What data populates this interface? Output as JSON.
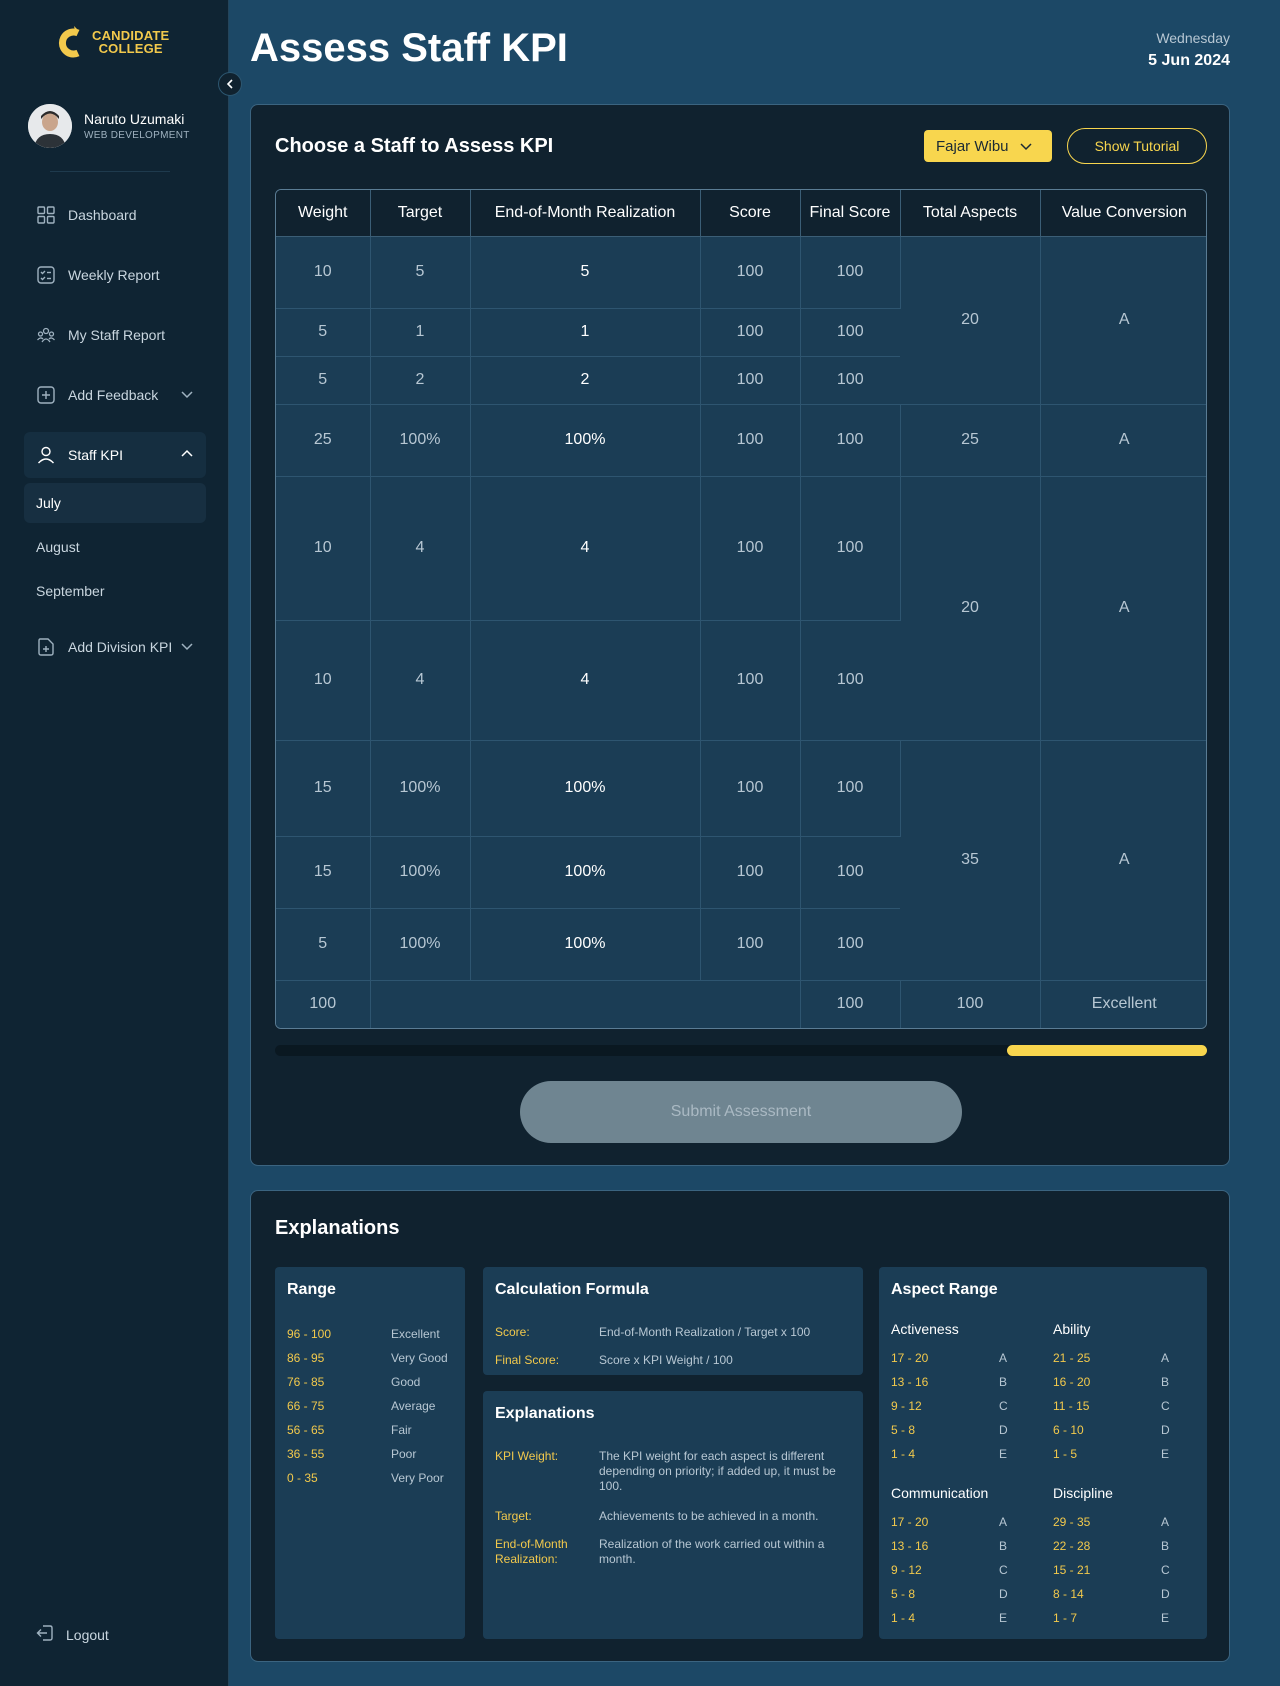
{
  "brand": {
    "line1": "CANDIDATE",
    "line2": "COLLEGE"
  },
  "user": {
    "name": "Naruto Uzumaki",
    "role": "WEB DEVELOPMENT"
  },
  "nav": {
    "dashboard": "Dashboard",
    "weekly": "Weekly Report",
    "staff_report": "My Staff Report",
    "feedback": "Add Feedback",
    "staff_kpi": "Staff KPI",
    "months": [
      "July",
      "August",
      "September"
    ],
    "division_kpi": "Add Division KPI",
    "logout": "Logout"
  },
  "header": {
    "title": "Assess Staff KPI",
    "day": "Wednesday",
    "date": "5 Jun 2024"
  },
  "assess": {
    "heading": "Choose a  Staff to Assess KPI",
    "selected_staff": "Fajar Wibu",
    "tutorial_label": "Show Tutorial",
    "submit_label": "Submit Assessment",
    "progress_fraction": [
      0.785,
      1.0
    ]
  },
  "table": {
    "headers": [
      "Weight",
      "Target",
      "End-of-Month Realization",
      "Score",
      "Final Score",
      "Total Aspects",
      "Value Conversion"
    ],
    "rows": [
      {
        "weight": "10",
        "target": "5",
        "realization": "5",
        "score": "100",
        "final": "100"
      },
      {
        "weight": "5",
        "target": "1",
        "realization": "1",
        "score": "100",
        "final": "100"
      },
      {
        "weight": "5",
        "target": "2",
        "realization": "2",
        "score": "100",
        "final": "100"
      },
      {
        "weight": "25",
        "target": "100%",
        "realization": "100%",
        "score": "100",
        "final": "100"
      },
      {
        "weight": "10",
        "target": "4",
        "realization": "4",
        "score": "100",
        "final": "100"
      },
      {
        "weight": "10",
        "target": "4",
        "realization": "4",
        "score": "100",
        "final": "100"
      },
      {
        "weight": "15",
        "target": "100%",
        "realization": "100%",
        "score": "100",
        "final": "100"
      },
      {
        "weight": "15",
        "target": "100%",
        "realization": "100%",
        "score": "100",
        "final": "100"
      },
      {
        "weight": "5",
        "target": "100%",
        "realization": "100%",
        "score": "100",
        "final": "100"
      }
    ],
    "groups": [
      {
        "total": "20",
        "value": "A"
      },
      {
        "total": "25",
        "value": "A"
      },
      {
        "total": "20",
        "value": "A"
      },
      {
        "total": "35",
        "value": "A"
      }
    ],
    "footer": {
      "weight": "100",
      "final": "100",
      "total": "100",
      "value": "Excellent"
    }
  },
  "explanations": {
    "title": "Explanations",
    "range": {
      "title": "Range",
      "items": [
        {
          "range": "96 - 100",
          "label": "Excellent"
        },
        {
          "range": "86 - 95",
          "label": "Very Good"
        },
        {
          "range": "76 - 85",
          "label": "Good"
        },
        {
          "range": "66 - 75",
          "label": "Average"
        },
        {
          "range": "56 - 65",
          "label": "Fair"
        },
        {
          "range": "36 - 55",
          "label": "Poor"
        },
        {
          "range": "0 - 35",
          "label": "Very Poor"
        }
      ]
    },
    "formula": {
      "title": "Calculation Formula",
      "items": [
        {
          "key": "Score:",
          "value": "End-of-Month Realization / Target x 100"
        },
        {
          "key": "Final Score:",
          "value": "Score x KPI Weight / 100"
        }
      ]
    },
    "definitions": {
      "title": "Explanations",
      "items": [
        {
          "key": "KPI Weight:",
          "value": "The KPI weight for each aspect is different depending on priority; if added up, it must be 100."
        },
        {
          "key": "Target:",
          "value": "Achievements to be achieved in a month."
        },
        {
          "key": "End-of-Month Realization:",
          "value": "Realization of the work carried out within a month."
        }
      ]
    },
    "aspect_range": {
      "title": "Aspect Range",
      "groups": [
        {
          "name": "Activeness",
          "items": [
            [
              "17 - 20",
              "A"
            ],
            [
              "13 - 16",
              "B"
            ],
            [
              "9 - 12",
              "C"
            ],
            [
              "5 - 8",
              "D"
            ],
            [
              "1 - 4",
              "E"
            ]
          ]
        },
        {
          "name": "Ability",
          "items": [
            [
              "21 - 25",
              "A"
            ],
            [
              "16 - 20",
              "B"
            ],
            [
              "11 - 15",
              "C"
            ],
            [
              "6 - 10",
              "D"
            ],
            [
              "1 - 5",
              "E"
            ]
          ]
        },
        {
          "name": "Communication",
          "items": [
            [
              "17 - 20",
              "A"
            ],
            [
              "13 - 16",
              "B"
            ],
            [
              "9 - 12",
              "C"
            ],
            [
              "5 - 8",
              "D"
            ],
            [
              "1 - 4",
              "E"
            ]
          ]
        },
        {
          "name": "Discipline",
          "items": [
            [
              "29 - 35",
              "A"
            ],
            [
              "22 - 28",
              "B"
            ],
            [
              "15 - 21",
              "C"
            ],
            [
              "8 - 14",
              "D"
            ],
            [
              "1 - 7",
              "E"
            ]
          ]
        }
      ]
    }
  }
}
